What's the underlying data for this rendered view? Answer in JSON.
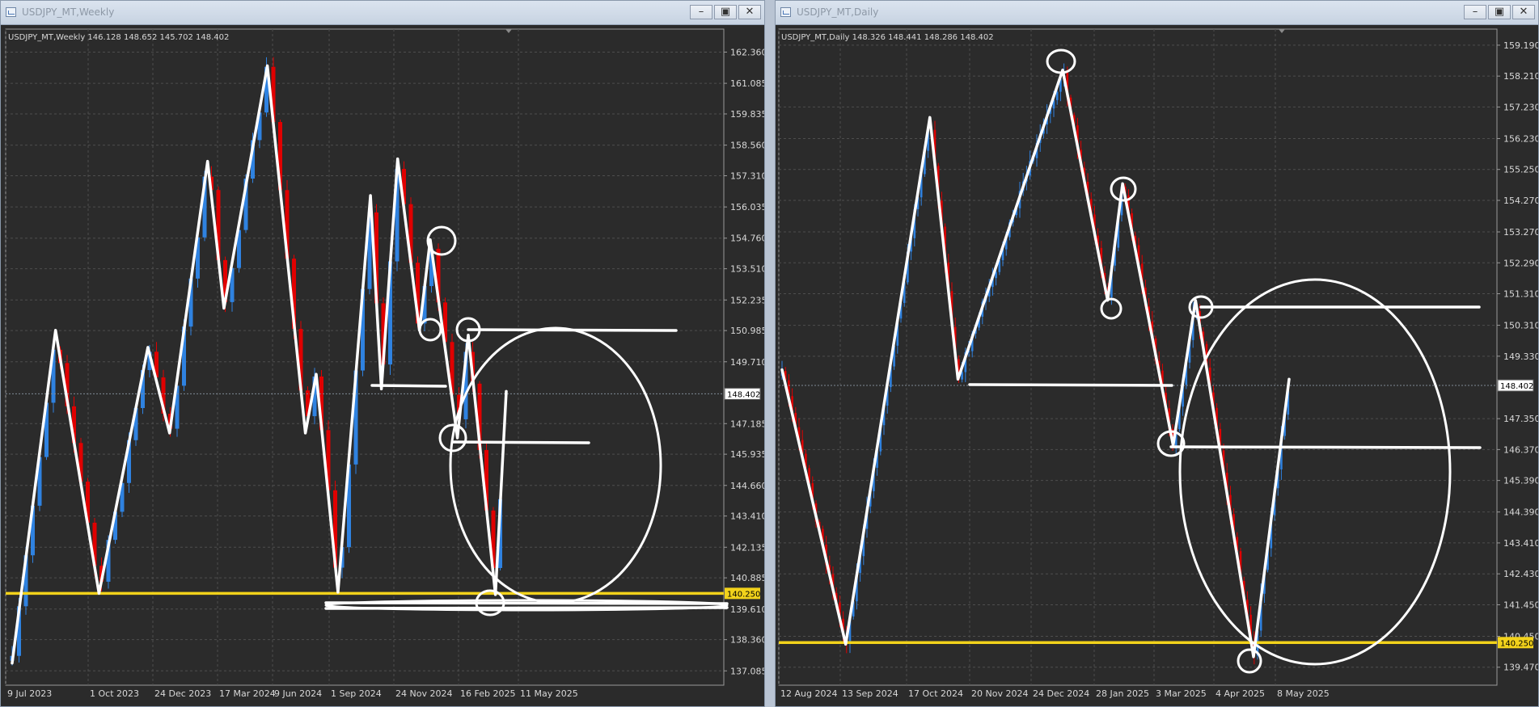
{
  "windows": [
    {
      "title": "USDJPY_MT,Weekly",
      "info": "USDJPY_MT,Weekly  146.128 148.652 145.702 148.402",
      "price_labels": [
        "162.360",
        "161.085",
        "159.835",
        "158.560",
        "157.310",
        "156.035",
        "154.760",
        "153.510",
        "152.235",
        "150.985",
        "149.710",
        "147.185",
        "145.935",
        "144.660",
        "143.410",
        "142.135",
        "140.885",
        "139.610",
        "138.360",
        "137.085"
      ],
      "current_price": "148.402",
      "level_price": "140.250",
      "date_labels": [
        "9 Jul 2023",
        "1 Oct 2023",
        "24 Dec 2023",
        "17 Mar 2024",
        "9 Jun 2024",
        "1 Sep 2024",
        "24 Nov 2024",
        "16 Feb 2025",
        "11 May 2025"
      ],
      "minimize_icon": "minimize-icon",
      "maximize_icon": "maximize-icon",
      "close_icon": "close-icon"
    },
    {
      "title": "USDJPY_MT,Daily",
      "info": "USDJPY_MT,Daily  148.326 148.441 148.286 148.402",
      "price_labels": [
        "159.190",
        "158.210",
        "157.230",
        "156.230",
        "155.250",
        "154.270",
        "153.270",
        "152.290",
        "151.310",
        "150.310",
        "149.330",
        "147.350",
        "146.370",
        "145.390",
        "144.390",
        "143.410",
        "142.430",
        "141.450",
        "140.450",
        "139.470"
      ],
      "current_price": "148.402",
      "level_price": "140.250",
      "date_labels": [
        "12 Aug 2024",
        "13 Sep 2024",
        "17 Oct 2024",
        "20 Nov 2024",
        "24 Dec 2024",
        "28 Jan 2025",
        "3 Mar 2025",
        "4 Apr 2025",
        "8 May 2025"
      ],
      "minimize_icon": "minimize-icon",
      "maximize_icon": "maximize-icon",
      "close_icon": "close-icon"
    }
  ],
  "chart_data": [
    {
      "type": "candlestick",
      "title": "USDJPY_MT,Weekly",
      "ylim": [
        136.5,
        163.3
      ],
      "y_ticks": [
        162.36,
        161.085,
        159.835,
        158.56,
        157.31,
        156.035,
        154.76,
        153.51,
        152.235,
        150.985,
        149.71,
        147.185,
        145.935,
        144.66,
        143.41,
        142.135,
        140.885,
        139.61,
        138.36,
        137.085
      ],
      "x_tick_labels": [
        "9 Jul 2023",
        "1 Oct 2023",
        "24 Dec 2023",
        "17 Mar 2024",
        "9 Jun 2024",
        "1 Sep 2024",
        "24 Nov 2024",
        "16 Feb 2025",
        "11 May 2025"
      ],
      "current_price": 148.402,
      "horizontal_level": 140.25,
      "colors": {
        "up": "#2f82e0",
        "down": "#e00000",
        "level": "#f2d21b",
        "drawing": "#ffffff",
        "background": "#2b2b2b",
        "grid": "#4e4e4e"
      },
      "zigzag_price_path": [
        {
          "date": "2023-07-23",
          "price": 137.4
        },
        {
          "date": "2023-09-17",
          "price": 151.0
        },
        {
          "date": "2023-11-12",
          "price": 140.25
        },
        {
          "date": "2024-01-14",
          "price": 150.3
        },
        {
          "date": "2024-02-11",
          "price": 146.8
        },
        {
          "date": "2024-03-31",
          "price": 157.9
        },
        {
          "date": "2024-04-21",
          "price": 151.9
        },
        {
          "date": "2024-06-16",
          "price": 161.8
        },
        {
          "date": "2024-08-04",
          "price": 146.8
        },
        {
          "date": "2024-08-18",
          "price": 149.2
        },
        {
          "date": "2024-09-15",
          "price": 140.3
        },
        {
          "date": "2024-10-27",
          "price": 156.5
        },
        {
          "date": "2024-11-10",
          "price": 148.6
        },
        {
          "date": "2024-12-01",
          "price": 158.0
        },
        {
          "date": "2024-12-29",
          "price": 151.0
        },
        {
          "date": "2025-01-12",
          "price": 154.7
        },
        {
          "date": "2025-02-16",
          "price": 146.6
        },
        {
          "date": "2025-03-02",
          "price": 150.8
        },
        {
          "date": "2025-04-06",
          "price": 140.2
        },
        {
          "date": "2025-04-20",
          "price": 148.5
        }
      ]
    },
    {
      "type": "candlestick",
      "title": "USDJPY_MT,Daily",
      "ylim": [
        138.9,
        159.7
      ],
      "y_ticks": [
        159.19,
        158.21,
        157.23,
        156.23,
        155.25,
        154.27,
        153.27,
        152.29,
        151.31,
        150.31,
        149.33,
        147.35,
        146.37,
        145.39,
        144.39,
        143.41,
        142.43,
        141.45,
        140.45,
        139.47
      ],
      "x_tick_labels": [
        "12 Aug 2024",
        "13 Sep 2024",
        "17 Oct 2024",
        "20 Nov 2024",
        "24 Dec 2024",
        "28 Jan 2025",
        "3 Mar 2025",
        "4 Apr 2025",
        "8 May 2025"
      ],
      "current_price": 148.402,
      "horizontal_level": 140.25,
      "colors": {
        "up": "#2f82e0",
        "down": "#e00000",
        "level": "#f2d21b",
        "drawing": "#ffffff",
        "background": "#2b2b2b",
        "grid": "#4e4e4e"
      },
      "zigzag_price_path": [
        {
          "date": "2024-08-13",
          "price": 148.9
        },
        {
          "date": "2024-09-16",
          "price": 140.2
        },
        {
          "date": "2024-10-31",
          "price": 156.9
        },
        {
          "date": "2024-11-15",
          "price": 148.6
        },
        {
          "date": "2025-01-10",
          "price": 158.4
        },
        {
          "date": "2025-02-03",
          "price": 151.1
        },
        {
          "date": "2025-02-11",
          "price": 154.8
        },
        {
          "date": "2025-03-10",
          "price": 146.5
        },
        {
          "date": "2025-03-22",
          "price": 151.1
        },
        {
          "date": "2025-04-22",
          "price": 139.8
        },
        {
          "date": "2025-05-11",
          "price": 148.6
        }
      ]
    }
  ]
}
